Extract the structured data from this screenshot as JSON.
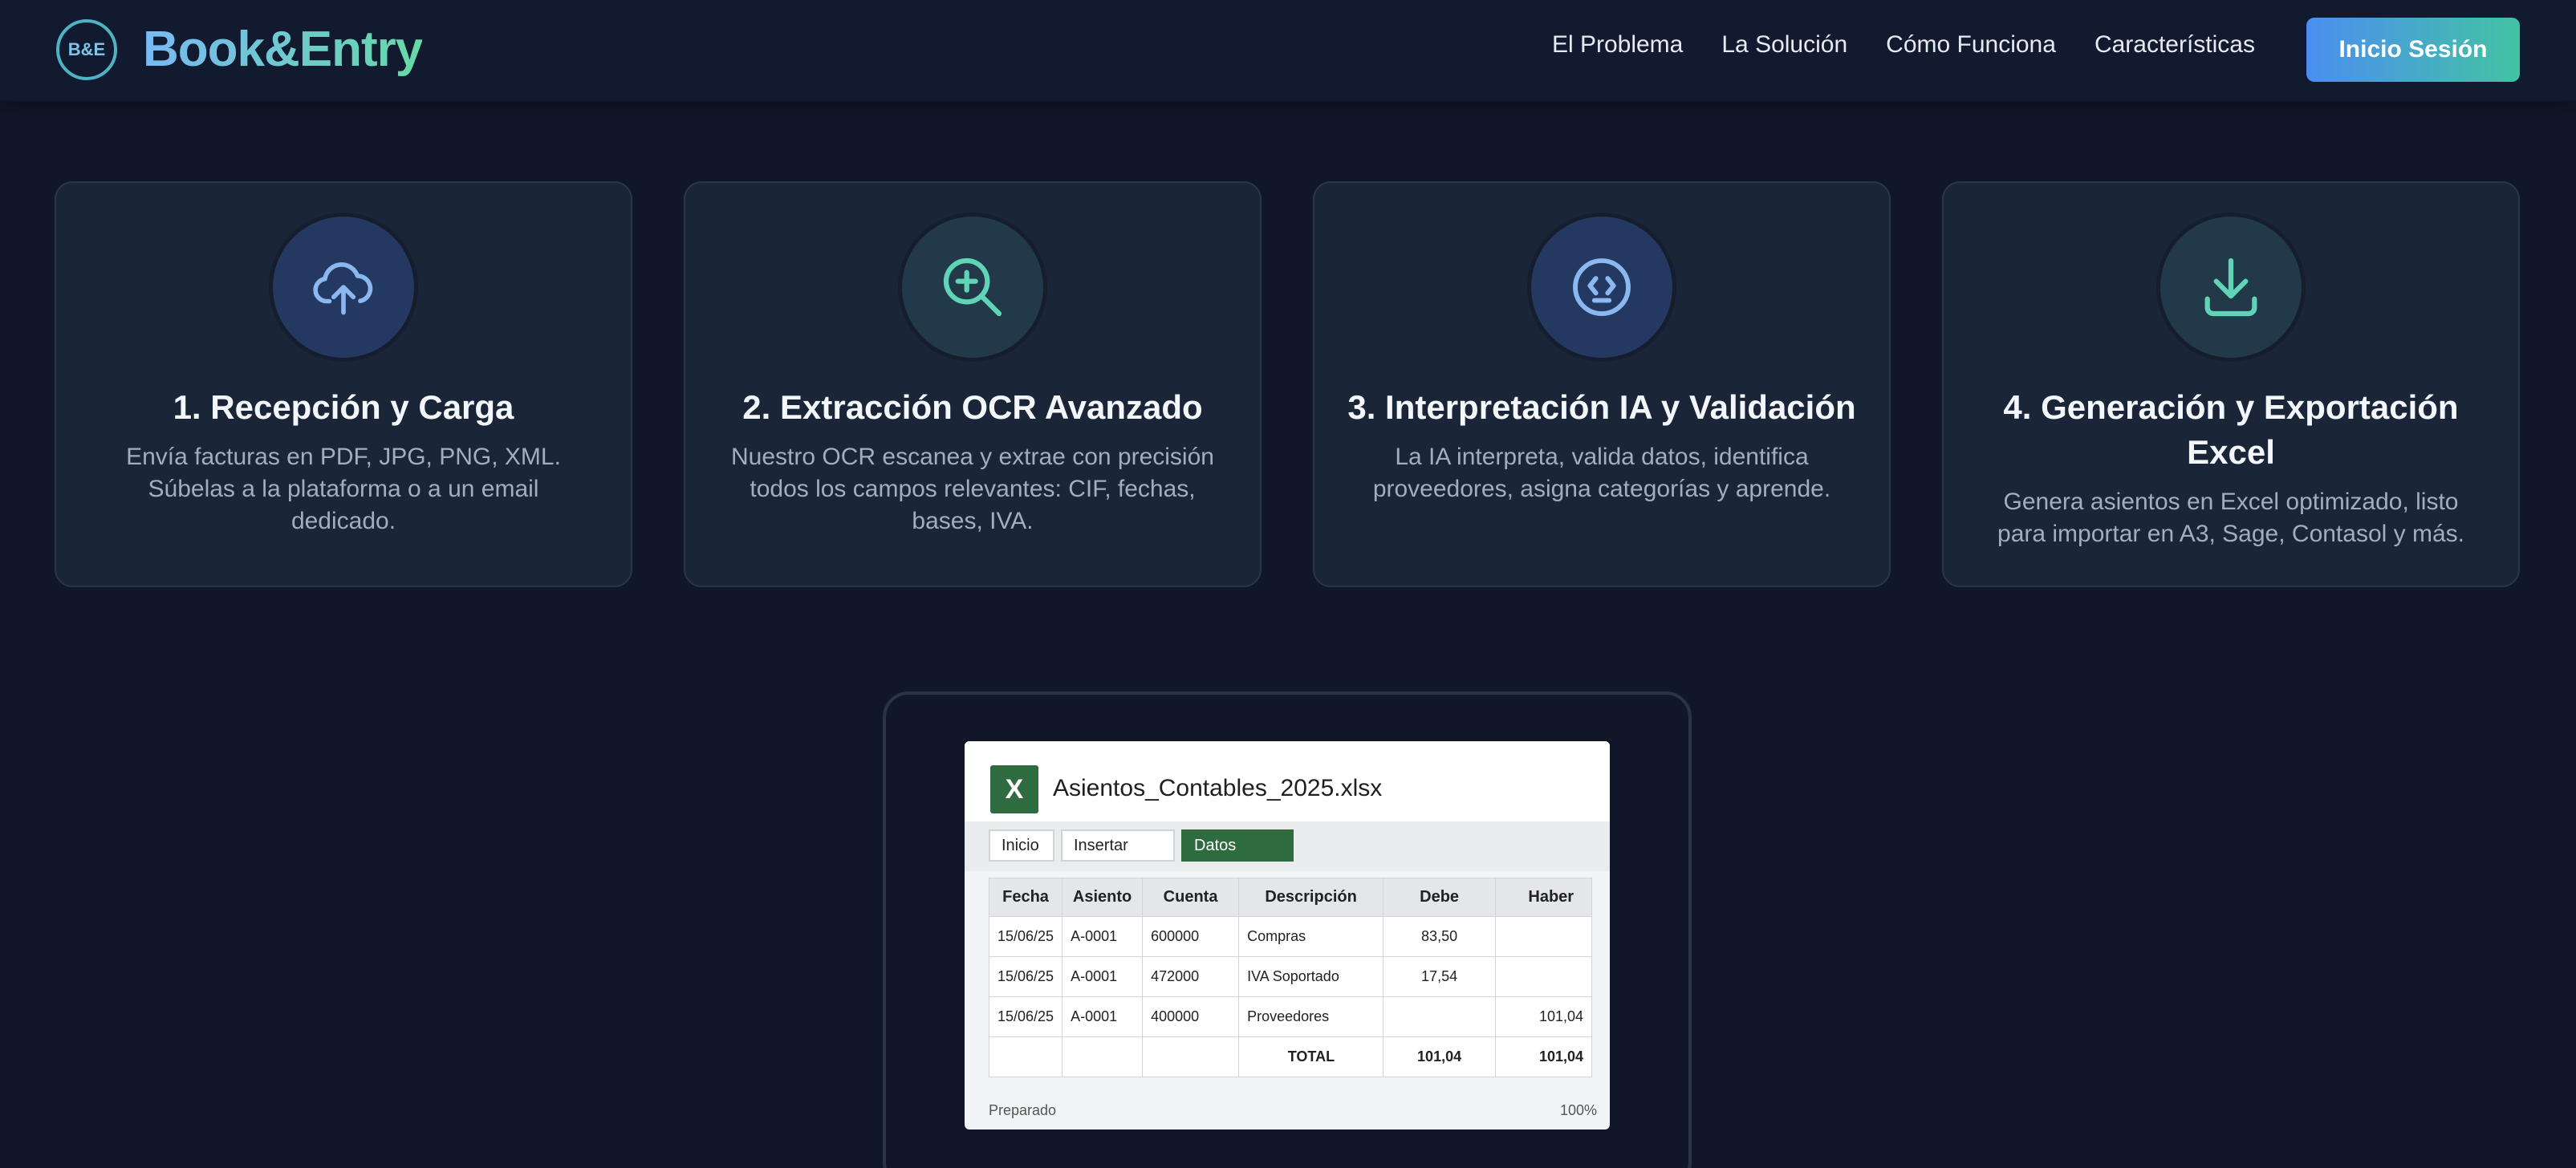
{
  "brand": {
    "badge": "B&E",
    "name": "Book&Entry"
  },
  "nav": [
    "El Problema",
    "La Solución",
    "Cómo Funciona",
    "Características"
  ],
  "login_label": "Inicio Sesión",
  "steps": [
    {
      "icon": "cloud-upload-icon",
      "title": "1. Recepción y Carga",
      "text": "Envía facturas en PDF, JPG, PNG, XML. Súbelas a la plataforma o a un email dedicado."
    },
    {
      "icon": "zoom-in-icon",
      "title": "2. Extracción OCR Avanzado",
      "text": "Nuestro OCR escanea y extrae con precisión todos los campos relevantes: CIF, fechas, bases, IVA."
    },
    {
      "icon": "code-face-icon",
      "title": "3. Interpretación IA y Validación",
      "text": "La IA interpreta, valida datos, identifica proveedores, asigna categorías y aprende."
    },
    {
      "icon": "download-icon",
      "title": "4. Generación y Exportación Excel",
      "text": "Genera asientos en Excel optimizado, listo para importar en A3, Sage, Contasol y más."
    }
  ],
  "excel": {
    "icon_letter": "X",
    "file_name": "Asientos_Contables_2025.xlsx",
    "tabs": [
      "Inicio",
      "Insertar",
      "Datos"
    ],
    "active_tab": "Datos",
    "columns": [
      "Fecha",
      "Asiento",
      "Cuenta",
      "Descripción",
      "Debe",
      "Haber"
    ],
    "rows": [
      [
        "15/06/25",
        "A-0001",
        "600000",
        "Compras",
        "83,50",
        ""
      ],
      [
        "15/06/25",
        "A-0001",
        "472000",
        "IVA Soportado",
        "17,54",
        ""
      ],
      [
        "15/06/25",
        "A-0001",
        "400000",
        "Proveedores",
        "",
        "101,04"
      ],
      [
        "",
        "",
        "",
        "TOTAL",
        "101,04",
        "101,04"
      ]
    ],
    "status": "Preparado",
    "zoom": "100%"
  },
  "colors": {
    "background": "#0f1729",
    "card": "#1b2538",
    "accent_blue": "#4b8ef0",
    "accent_teal": "#43c3a3",
    "excel_green": "#2e6b3e"
  }
}
